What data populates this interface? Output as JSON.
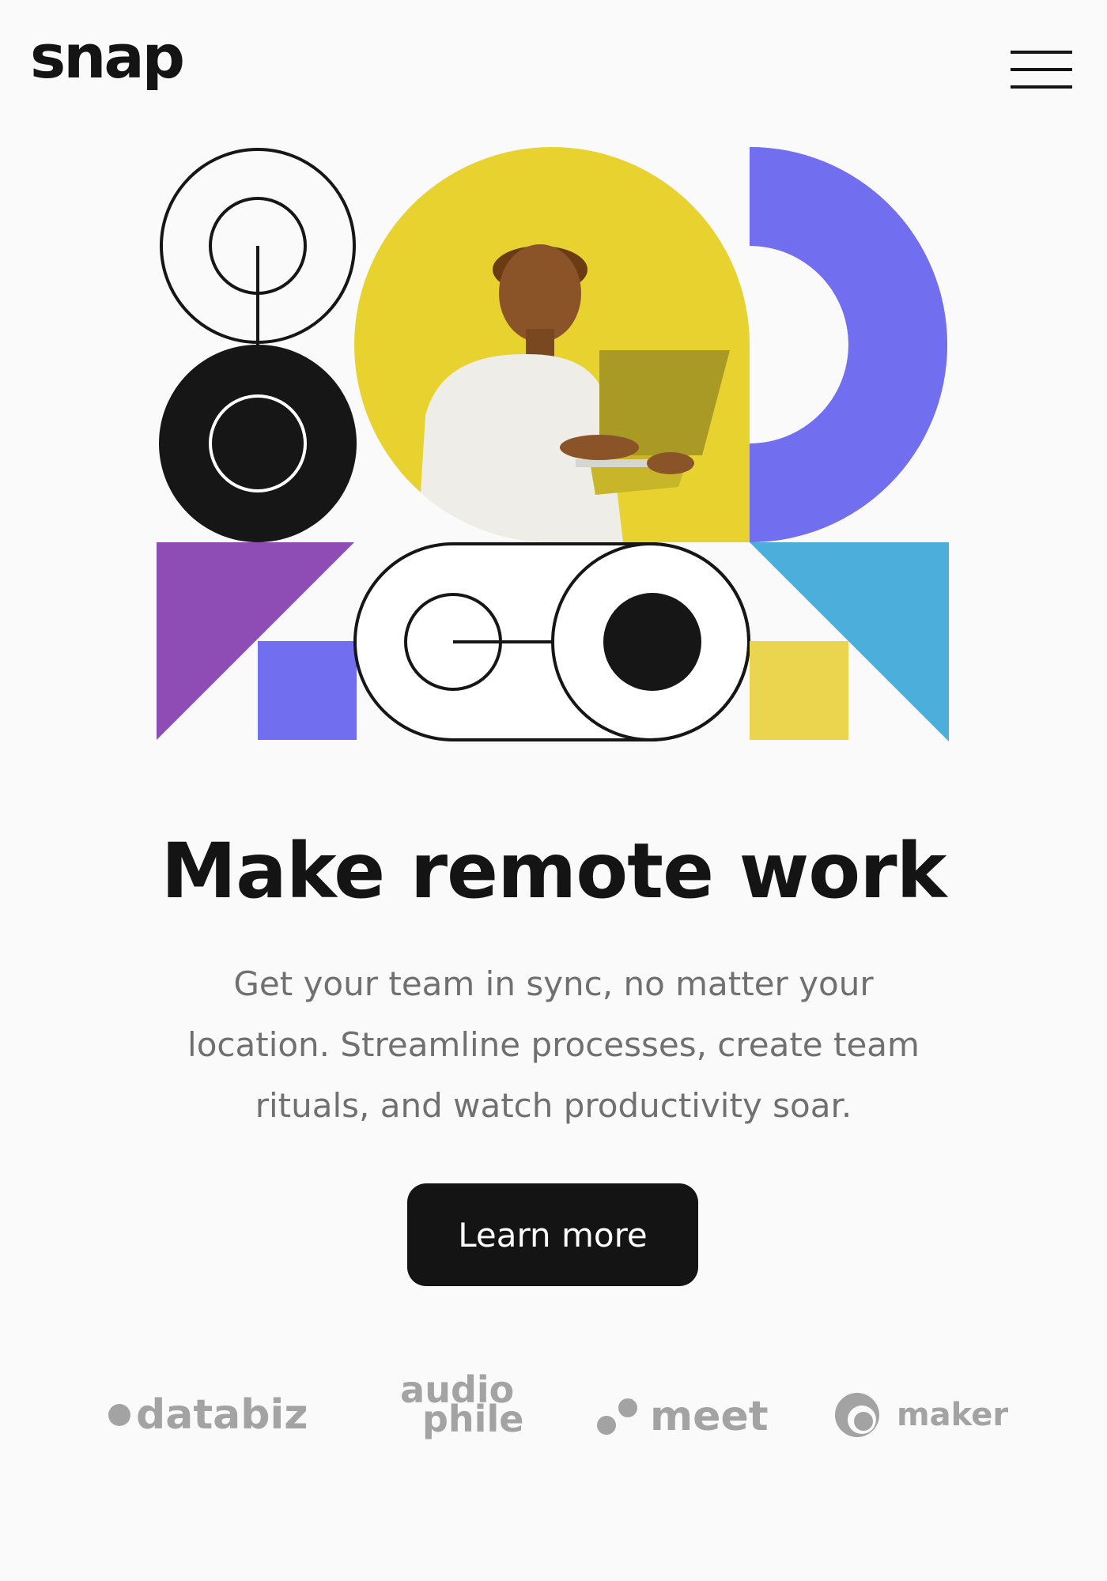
{
  "header": {
    "logo_text": "snap",
    "menu_icon": "hamburger-menu-icon"
  },
  "hero": {
    "image_description_icon": "person-with-laptop-illustration",
    "colors": {
      "yellow": "#e8d230",
      "indigo": "#726ef0",
      "purple": "#8d4db5",
      "sky": "#4caedb",
      "black": "#161616",
      "sand": "#ecd54e"
    }
  },
  "main": {
    "headline": "Make remote work",
    "subtext": "Get your team in sync, no matter your location. Streamline processes, create team rituals, and watch productivity soar.",
    "cta_label": "Learn more"
  },
  "clients": {
    "databiz": "databiz",
    "audiophile_top": "audio",
    "audiophile_bottom": "phile",
    "meet": "meet",
    "maker": "maker"
  }
}
